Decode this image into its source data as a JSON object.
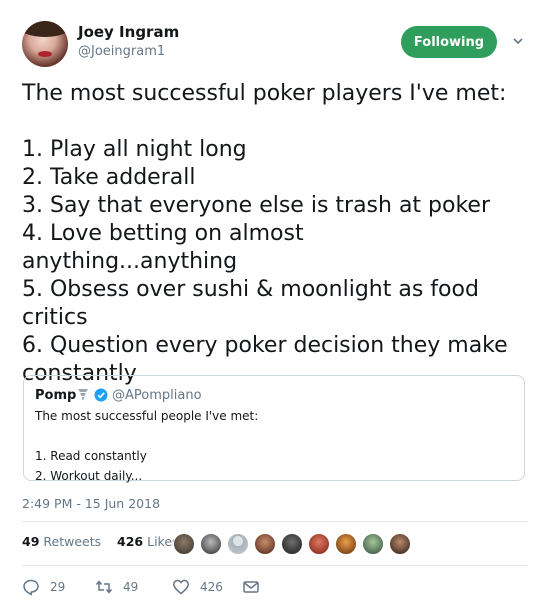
{
  "author": {
    "name": "Joey Ingram",
    "handle": "@Joeingram1",
    "follow_label": "Following"
  },
  "tweet": {
    "text": "The most successful poker players I've met:\n\n1. Play all night long\n2. Take adderall\n3. Say that everyone else is trash at poker\n4. Love betting on almost anything...anything\n5. Obsess over sushi & moonlight as food critics\n6. Question every poker decision they make constantly"
  },
  "quote": {
    "name": "Pomp",
    "handle": "@APompliano",
    "text": "The most successful people I've met:\n\n1. Read constantly\n2. Workout daily..."
  },
  "meta": {
    "timestamp": "2:49 PM - 15 Jun 2018",
    "retweets_count": "49",
    "retweets_label": "Retweets",
    "likes_count": "426",
    "likes_label": "Likes"
  },
  "liker_avatars": [
    "avatar-1",
    "avatar-2",
    "avatar-3",
    "avatar-4",
    "avatar-5",
    "avatar-6",
    "avatar-7",
    "avatar-8",
    "avatar-9"
  ],
  "actions": {
    "reply_count": "29",
    "retweet_count": "49",
    "like_count": "426"
  },
  "colors": {
    "following_button": "#2f9e5c",
    "verified": "#1da1f2",
    "muted_text": "#657786",
    "border": "#e6ecf0"
  }
}
